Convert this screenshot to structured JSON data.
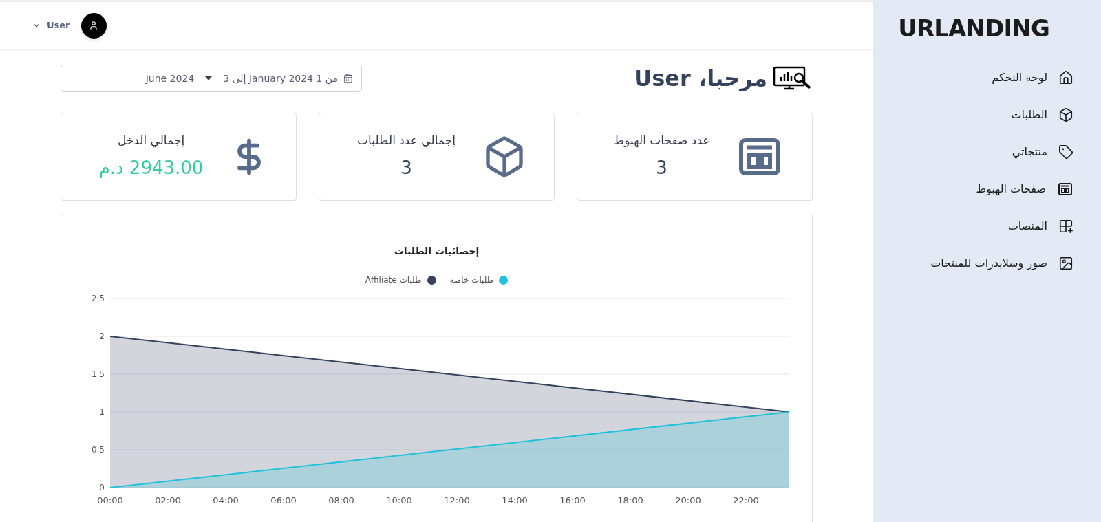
{
  "header": {
    "user_menu": {
      "label": "User"
    }
  },
  "date_range": {
    "text": "من 1 January 2024 إلى 3",
    "end": "June 2024"
  },
  "welcome": {
    "title": "مرحبا، User"
  },
  "stats": [
    {
      "label": "عدد صفحات الهبوط",
      "value": "3",
      "kind": "count"
    },
    {
      "label": "إجمالي عدد الطلبات",
      "value": "3",
      "kind": "count"
    },
    {
      "label": "إجمالي الدخل",
      "value": "2943.00 د.م",
      "kind": "money"
    }
  ],
  "orders_chart": {
    "chart_data": {
      "type": "area",
      "title": "إحصائيات الطلبات",
      "x": [
        0,
        23.5
      ],
      "xlim": [
        0,
        23.5
      ],
      "ylim": [
        0,
        2.5
      ],
      "xticks": [
        {
          "value": 0,
          "label": "00:00"
        },
        {
          "value": 2,
          "label": "02:00"
        },
        {
          "value": 4,
          "label": "04:00"
        },
        {
          "value": 6,
          "label": "06:00"
        },
        {
          "value": 8,
          "label": "08:00"
        },
        {
          "value": 10,
          "label": "10:00"
        },
        {
          "value": 12,
          "label": "12:00"
        },
        {
          "value": 14,
          "label": "14:00"
        },
        {
          "value": 16,
          "label": "16:00"
        },
        {
          "value": 18,
          "label": "18:00"
        },
        {
          "value": 20,
          "label": "20:00"
        },
        {
          "value": 22,
          "label": "22:00"
        }
      ],
      "yticks": [
        0,
        0.5,
        1,
        1.5,
        2,
        2.5
      ],
      "grid": true,
      "series": [
        {
          "name": "طلبات خاصة",
          "color": "#1ec2da",
          "values": [
            0,
            1
          ]
        },
        {
          "name": "طلبات Affiliate",
          "color": "#34425e",
          "values": [
            2,
            1
          ]
        }
      ]
    }
  },
  "sidebar": {
    "brand": "URLANDING",
    "items": [
      {
        "label": "لوحة التحكم"
      },
      {
        "label": "الطلبات"
      },
      {
        "label": "منتجاتي"
      },
      {
        "label": "صفحات الهبوط"
      },
      {
        "label": "المنصات"
      },
      {
        "label": "صور وسلايدرات للمنتجات"
      }
    ]
  }
}
